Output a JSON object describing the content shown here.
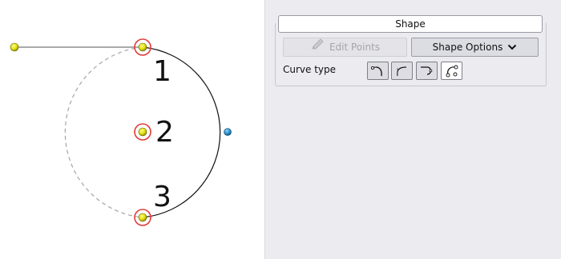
{
  "canvas": {
    "point_labels": [
      "1",
      "2",
      "3"
    ]
  },
  "panel": {
    "title": "Shape",
    "edit_points_label": "Edit Points",
    "shape_options_label": "Shape Options",
    "curve_type_label": "Curve type",
    "curve_type_buttons": [
      {
        "icon": "curve-smooth-icon"
      },
      {
        "icon": "curve-corner-icon"
      },
      {
        "icon": "curve-loop-icon"
      },
      {
        "icon": "curve-points-icon"
      }
    ]
  },
  "colors": {
    "panel_bg": "#ebebf0",
    "point_fill": "#e7e40f",
    "point_highlight_ring": "#e23a3a",
    "handle_fill": "#2a8bc4"
  }
}
